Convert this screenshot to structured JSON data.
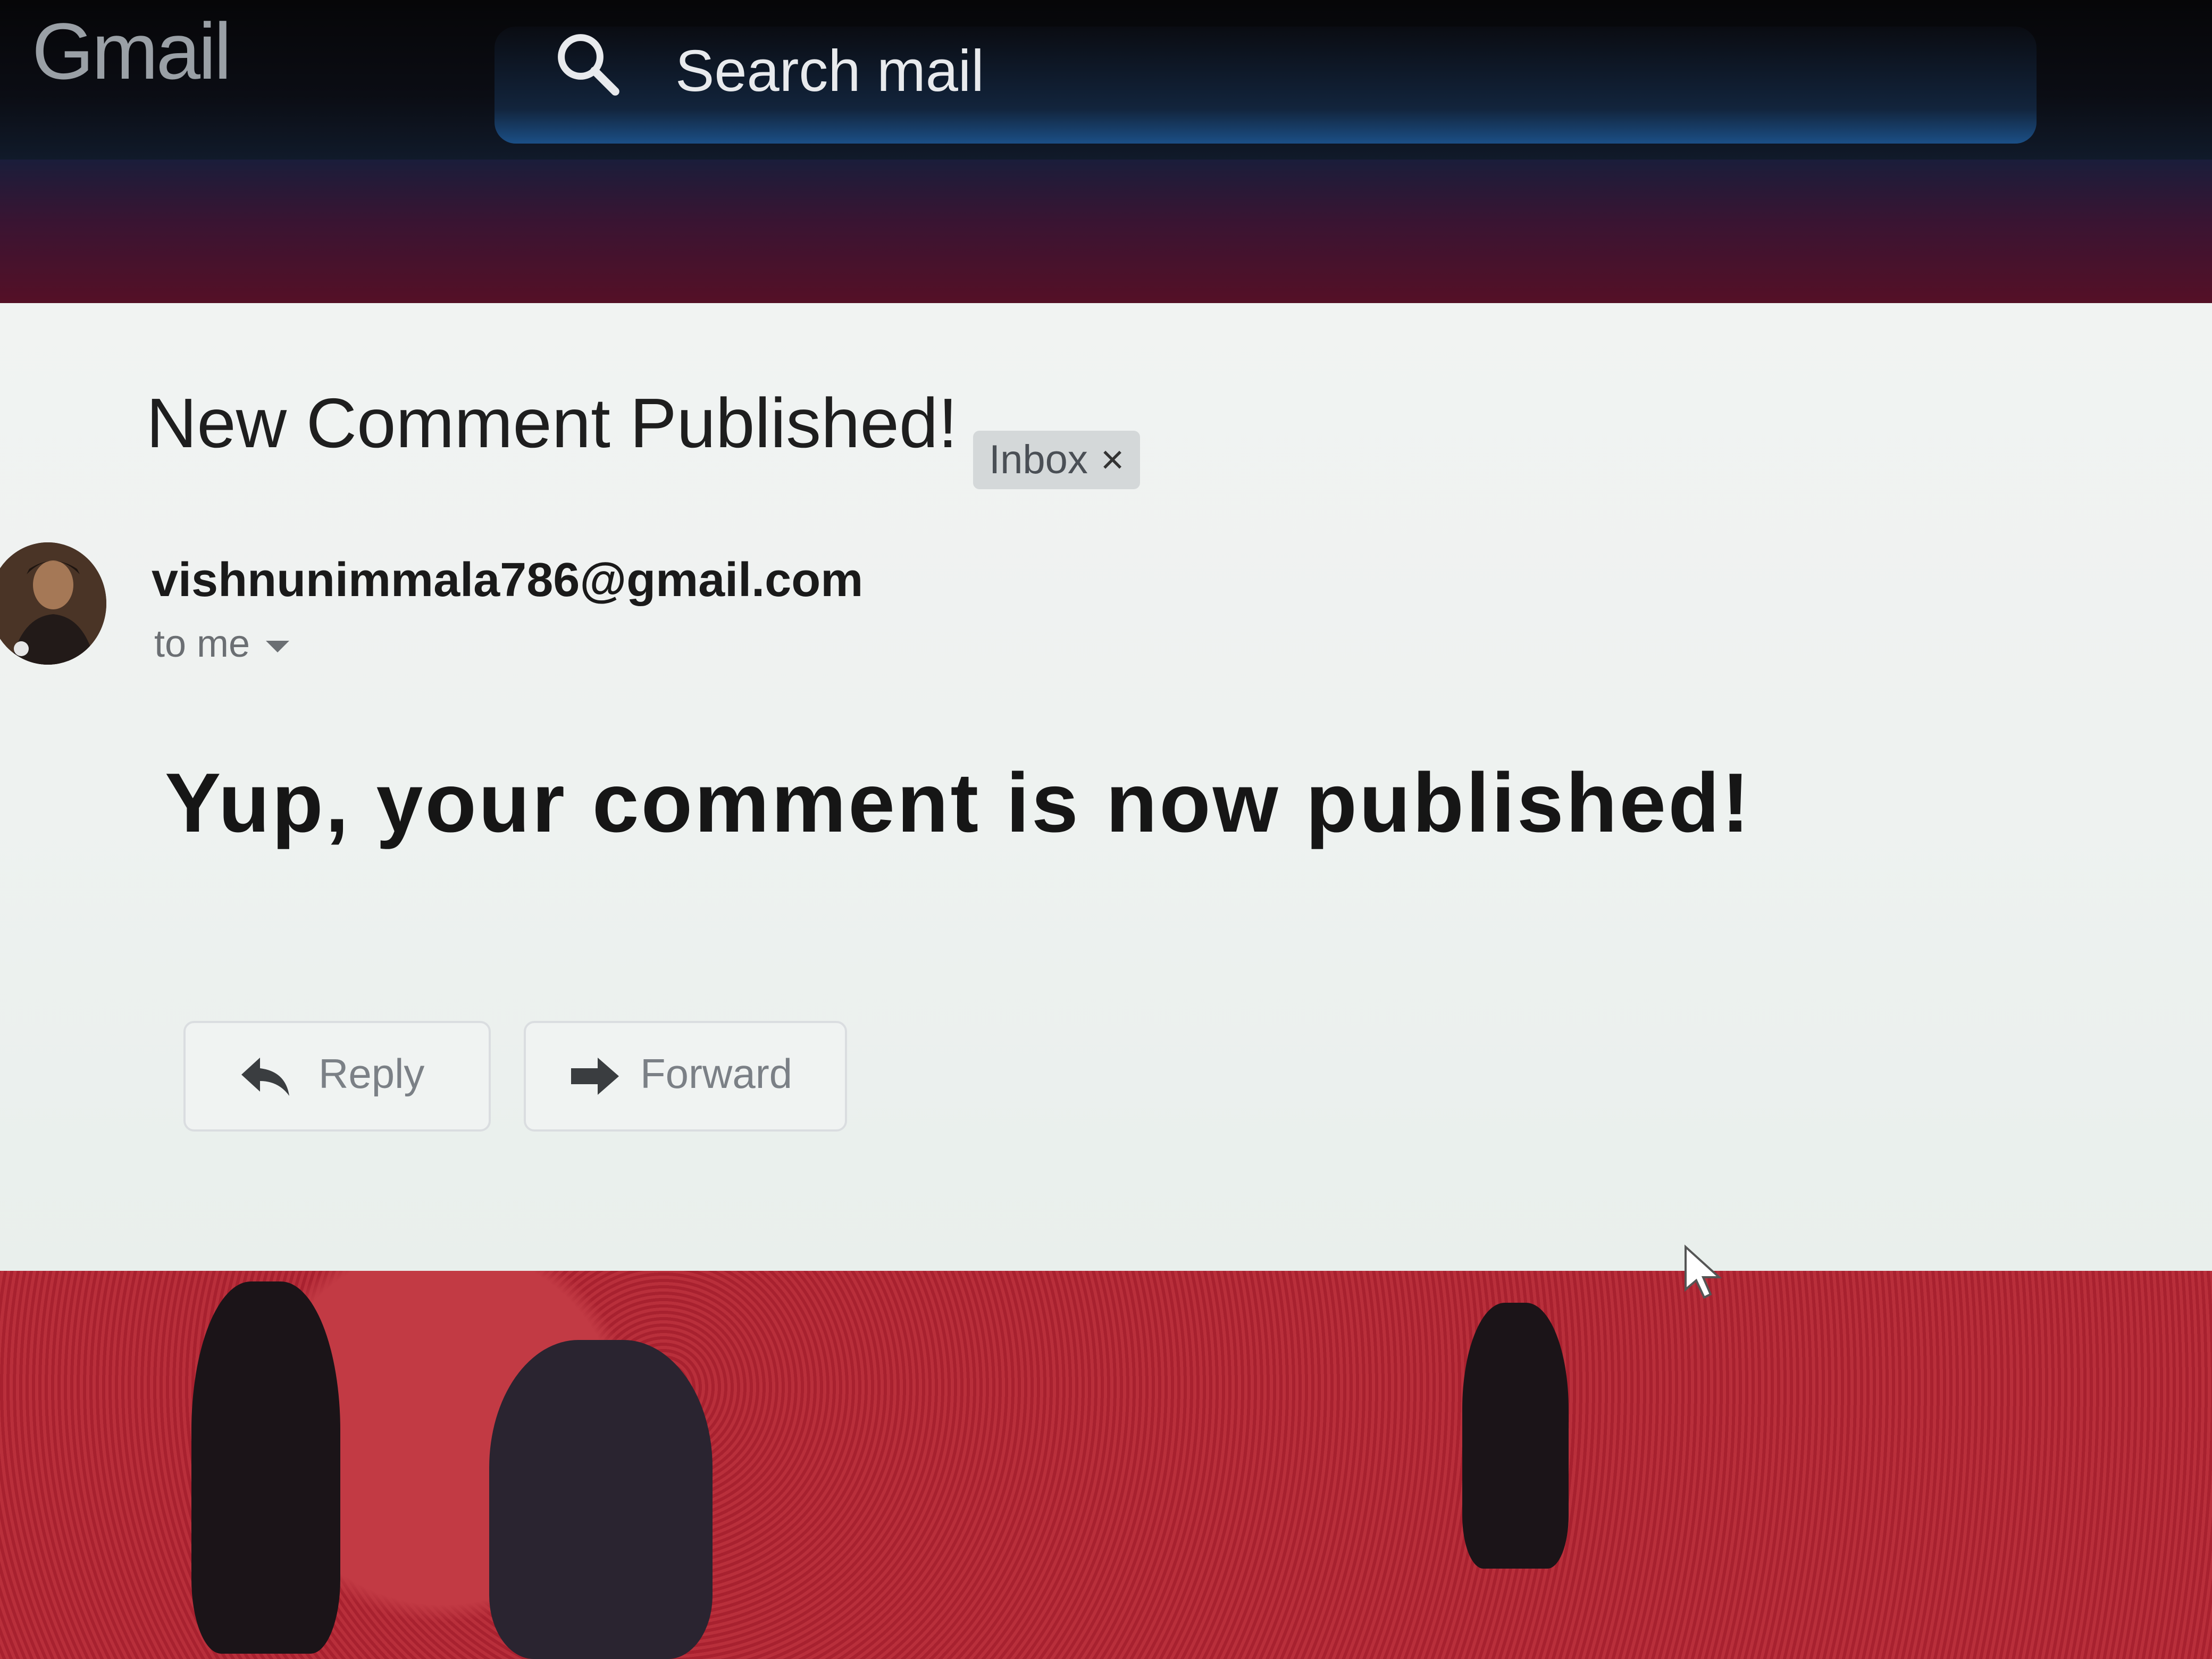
{
  "header": {
    "logo_text": "Gmail",
    "search_placeholder": "Search mail"
  },
  "toolbar": {
    "icons": [
      "archive-icon",
      "report-spam-icon",
      "delete-icon",
      "mark-unread-icon",
      "snooze-icon",
      "move-to-icon",
      "label-icon",
      "more-options-icon"
    ]
  },
  "email": {
    "subject": "New Comment Published!",
    "label_chip": "Inbox",
    "label_chip_close": "×",
    "sender": "vishnunimmala786@gmail.com",
    "recipient_line": "to me",
    "body": "Yup, your comment is now published!",
    "reply_label": "Reply",
    "forward_label": "Forward"
  },
  "colors": {
    "header_bg": "#060608",
    "toolbar_accent": "#5a0f24",
    "card_bg": "#f1f3f2",
    "theme_red": "#b8303a"
  }
}
